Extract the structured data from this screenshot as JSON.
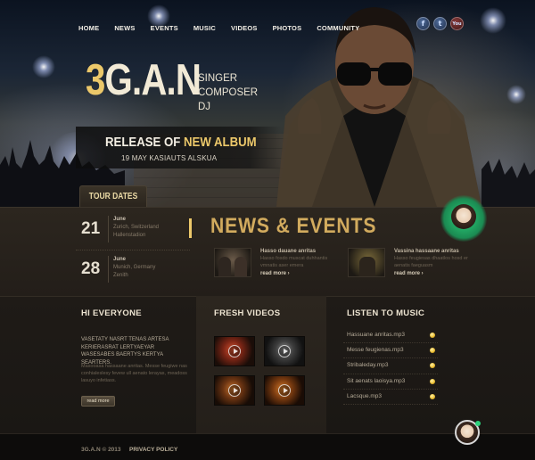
{
  "nav": {
    "items": [
      "HOME",
      "NEWS",
      "EVENTS",
      "MUSIC",
      "VIDEOS",
      "PHOTOS",
      "COMMUNITY"
    ]
  },
  "social": {
    "facebook": "f",
    "twitter": "t",
    "youtube": "You"
  },
  "hero": {
    "brand_number": "3",
    "brand_rest": "G.A.N",
    "roles": [
      "SINGER",
      "COMPOSER",
      "DJ"
    ],
    "album_prefix": "RELEASE OF",
    "album_highlight": "NEW ALBUM",
    "album_date": "19 MAY KASIAUTS ALSKUA"
  },
  "tour": {
    "tab_label": "TOUR DATES",
    "dates": [
      {
        "day": "21",
        "month": "June",
        "line1": "Zurich, Switzerland",
        "line2": "Hallenstadion"
      },
      {
        "day": "28",
        "month": "June",
        "line1": "Munich, Germany",
        "line2": "Zenith"
      }
    ]
  },
  "news": {
    "title": "NEWS & EVENTS",
    "items": [
      {
        "head": "Hasso dauane anritas",
        "text": "Hasso fosdo muscat duhhantis vmnatis aser emera",
        "more": "read more ›"
      },
      {
        "head": "Vassina hassaane anritas",
        "text": "Hasso feugiesas dhaatlos hosd er aenatis faeguasm",
        "more": "read more ›"
      }
    ]
  },
  "columns": {
    "hi_title": "HI EVERYONE",
    "hi_caps": "VASETATY NASRT TENAS ARTESA KERIERASRAT LERTYAEYAR WASESABES BAERTYS KERTYA SEARTERS.",
    "hi_body": "Masooasa hassaane anritas. Messe feugiwe nas conhialeslesy fevew ull aenato lerayas, meadoss lasuyo infetiass.",
    "hi_button": "read more",
    "videos_title": "FRESH VIDEOS",
    "music_title": "LISTEN TO MUSIC",
    "tracks": [
      "Hassuane anritas.mp3",
      "Messe feugienas.mp3",
      "Stribaleday.mp3",
      "Sit aenats laoisya.mp3",
      "Lacsque.mp3"
    ]
  },
  "footer": {
    "copyright": "3G.A.N © 2013",
    "privacy": "PRIVACY POLICY"
  }
}
